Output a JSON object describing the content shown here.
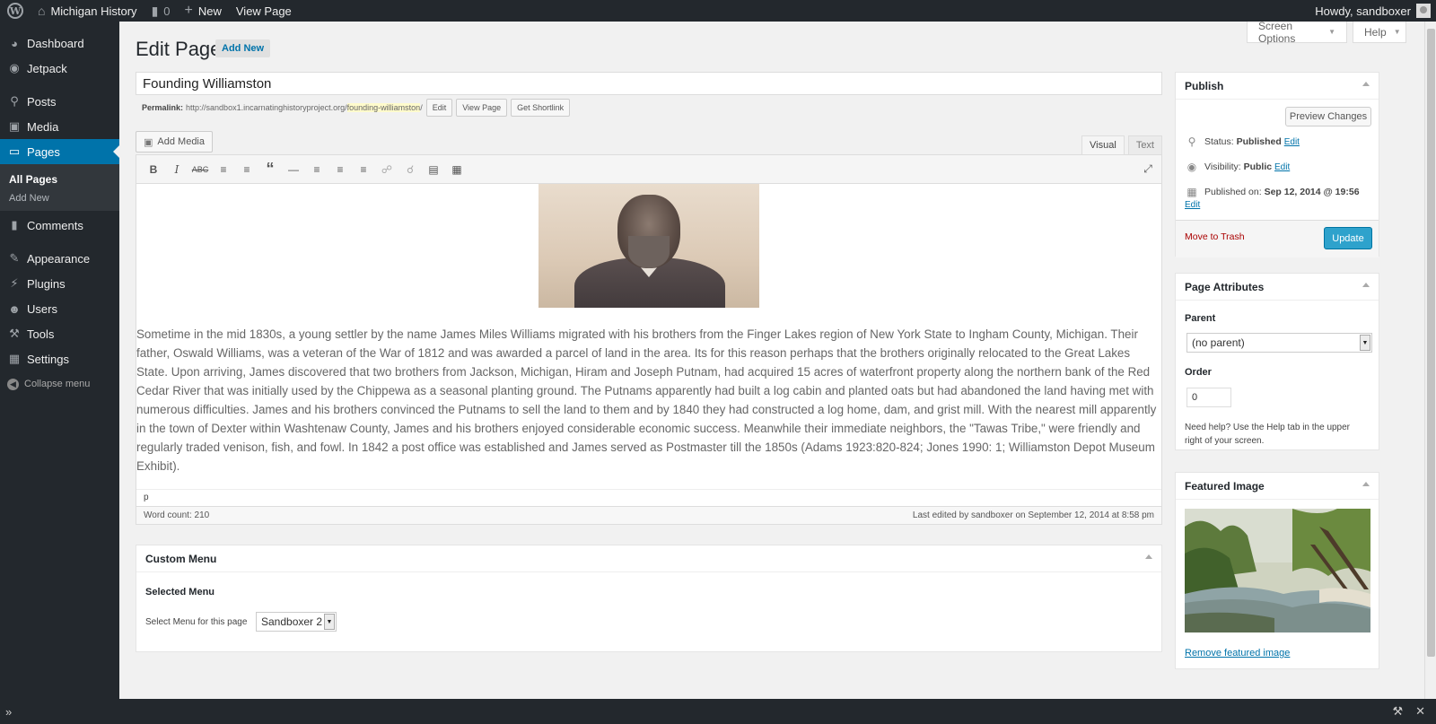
{
  "admin_bar": {
    "site_name": "Michigan History",
    "comments_count": "0",
    "new_label": "New",
    "view_page": "View Page",
    "greeting": "Howdy, sandboxer"
  },
  "sidebar": {
    "items": [
      {
        "label": "Dashboard",
        "icon": "dashboard-icon"
      },
      {
        "label": "Jetpack",
        "icon": "jetpack-icon"
      },
      {
        "label": "Posts",
        "icon": "pin-icon"
      },
      {
        "label": "Media",
        "icon": "media-icon"
      },
      {
        "label": "Pages",
        "icon": "pages-icon"
      },
      {
        "label": "Comments",
        "icon": "comments-icon"
      },
      {
        "label": "Appearance",
        "icon": "brush-icon"
      },
      {
        "label": "Plugins",
        "icon": "plug-icon"
      },
      {
        "label": "Users",
        "icon": "users-icon"
      },
      {
        "label": "Tools",
        "icon": "wrench-icon"
      },
      {
        "label": "Settings",
        "icon": "settings-icon"
      }
    ],
    "submenu": [
      "All Pages",
      "Add New"
    ],
    "collapse": "Collapse menu"
  },
  "header": {
    "title": "Edit Page",
    "add_new": "Add New",
    "screen_options": "Screen Options",
    "help": "Help"
  },
  "post": {
    "title": "Founding Williamston",
    "permalink_label": "Permalink:",
    "permalink_base": "http://sandbox1.incarnatinghistoryproject.org/",
    "permalink_slug": "founding-williamston",
    "permalink_tail": "/",
    "permalink_buttons": [
      "Edit",
      "View Page",
      "Get Shortlink"
    ]
  },
  "editor": {
    "add_media": "Add Media",
    "tabs": [
      "Visual",
      "Text"
    ],
    "content": "Sometime in the mid 1830s, a young settler by the name James Miles Williams migrated with his brothers from the Finger Lakes region of New York State to Ingham County, Michigan. Their father, Oswald Williams, was a veteran of the War of 1812 and was awarded a parcel of land in the area. Its for this reason perhaps that the brothers originally relocated to the Great Lakes State. Upon arriving, James discovered that two brothers from Jackson, Michigan, Hiram and Joseph Putnam, had acquired 15 acres of waterfront property along the northern bank of the Red Cedar River that was initially used by the Chippewa as a seasonal planting ground. The Putnams apparently had built a log cabin and planted oats but had abandoned the land having met with numerous difficulties. James and his brothers convinced the Putnams to sell the land to them and by 1840 they had constructed a log home, dam, and grist mill. With the nearest mill apparently in the town of Dexter within Washtenaw County, James and his brothers enjoyed considerable economic success. Meanwhile their immediate neighbors, the \"Tawas Tribe,\" were friendly and regularly traded venison, fish, and fowl. In 1842 a post office was established and James served as Postmaster till the 1850s (Adams 1923:820-824; Jones 1990: 1; Williamston Depot Museum Exhibit).",
    "path": "p",
    "word_count": "Word count: 210",
    "last_edited": "Last edited by sandboxer on September 12, 2014 at 8:58 pm"
  },
  "custom_menu": {
    "title": "Custom Menu",
    "subtitle": "Selected Menu",
    "select_label": "Select Menu for this page",
    "selected": "Sandboxer 2"
  },
  "publish": {
    "title": "Publish",
    "preview": "Preview Changes",
    "status_label": "Status:",
    "status_value": "Published",
    "visibility_label": "Visibility:",
    "visibility_value": "Public",
    "published_label": "Published on:",
    "published_value": "Sep 12, 2014 @ 19:56",
    "edit": "Edit",
    "trash": "Move to Trash",
    "update": "Update"
  },
  "page_attributes": {
    "title": "Page Attributes",
    "parent_label": "Parent",
    "parent_value": "(no parent)",
    "order_label": "Order",
    "order_value": "0",
    "help_text": "Need help? Use the Help tab in the upper right of your screen."
  },
  "featured_image": {
    "title": "Featured Image",
    "remove": "Remove featured image"
  },
  "colors": {
    "admin_dark": "#23282d",
    "accent": "#0073aa",
    "primary_button": "#2ea2cc",
    "trash": "#a00"
  }
}
